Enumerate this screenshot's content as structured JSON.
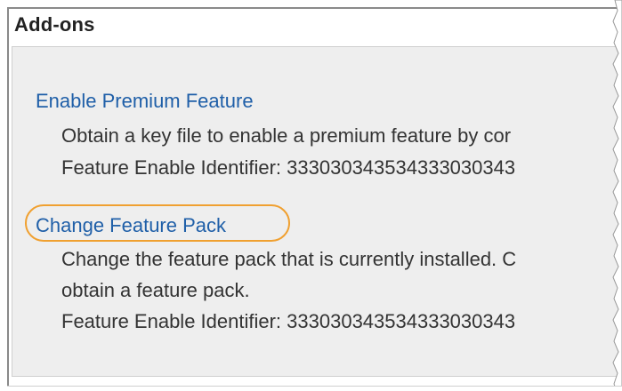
{
  "panel": {
    "title": "Add-ons"
  },
  "addons": [
    {
      "link": "Enable Premium Feature",
      "description_lines": [
        "Obtain a key file to enable a premium feature by cor",
        "Feature Enable Identifier: 333030343534333030343"
      ]
    },
    {
      "link": "Change Feature Pack",
      "description_lines": [
        "Change the feature pack that is currently installed. C",
        "obtain a feature pack.",
        "Feature Enable Identifier: 333030343534333030343"
      ]
    }
  ],
  "colors": {
    "link": "#1f5fa8",
    "highlight": "#f0a030",
    "panel_bg": "#eeeeee"
  }
}
